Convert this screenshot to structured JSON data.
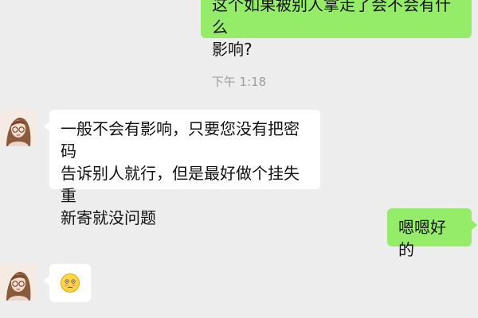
{
  "chat": {
    "messages": [
      {
        "direction": "out",
        "text": "这个如果被别人拿走了会不会有什么\n影响?"
      },
      {
        "direction": "in",
        "text": "一般不会有影响，只要您没有把密码\n告诉别人就行，但是最好做个挂失重\n新寄就没问题"
      },
      {
        "direction": "out",
        "text": "嗯嗯好的"
      },
      {
        "direction": "in",
        "emoji": "flushed-emoji",
        "text": ""
      }
    ],
    "timestamp": "下午 1:18"
  },
  "colors": {
    "background": "#EDEDED",
    "outgoing_bubble": "#95EC69",
    "incoming_bubble": "#FFFFFF",
    "timestamp_text": "#9E9E9E"
  },
  "icons": {
    "avatar": "agent-avatar",
    "emoji": "flushed-emoji"
  }
}
